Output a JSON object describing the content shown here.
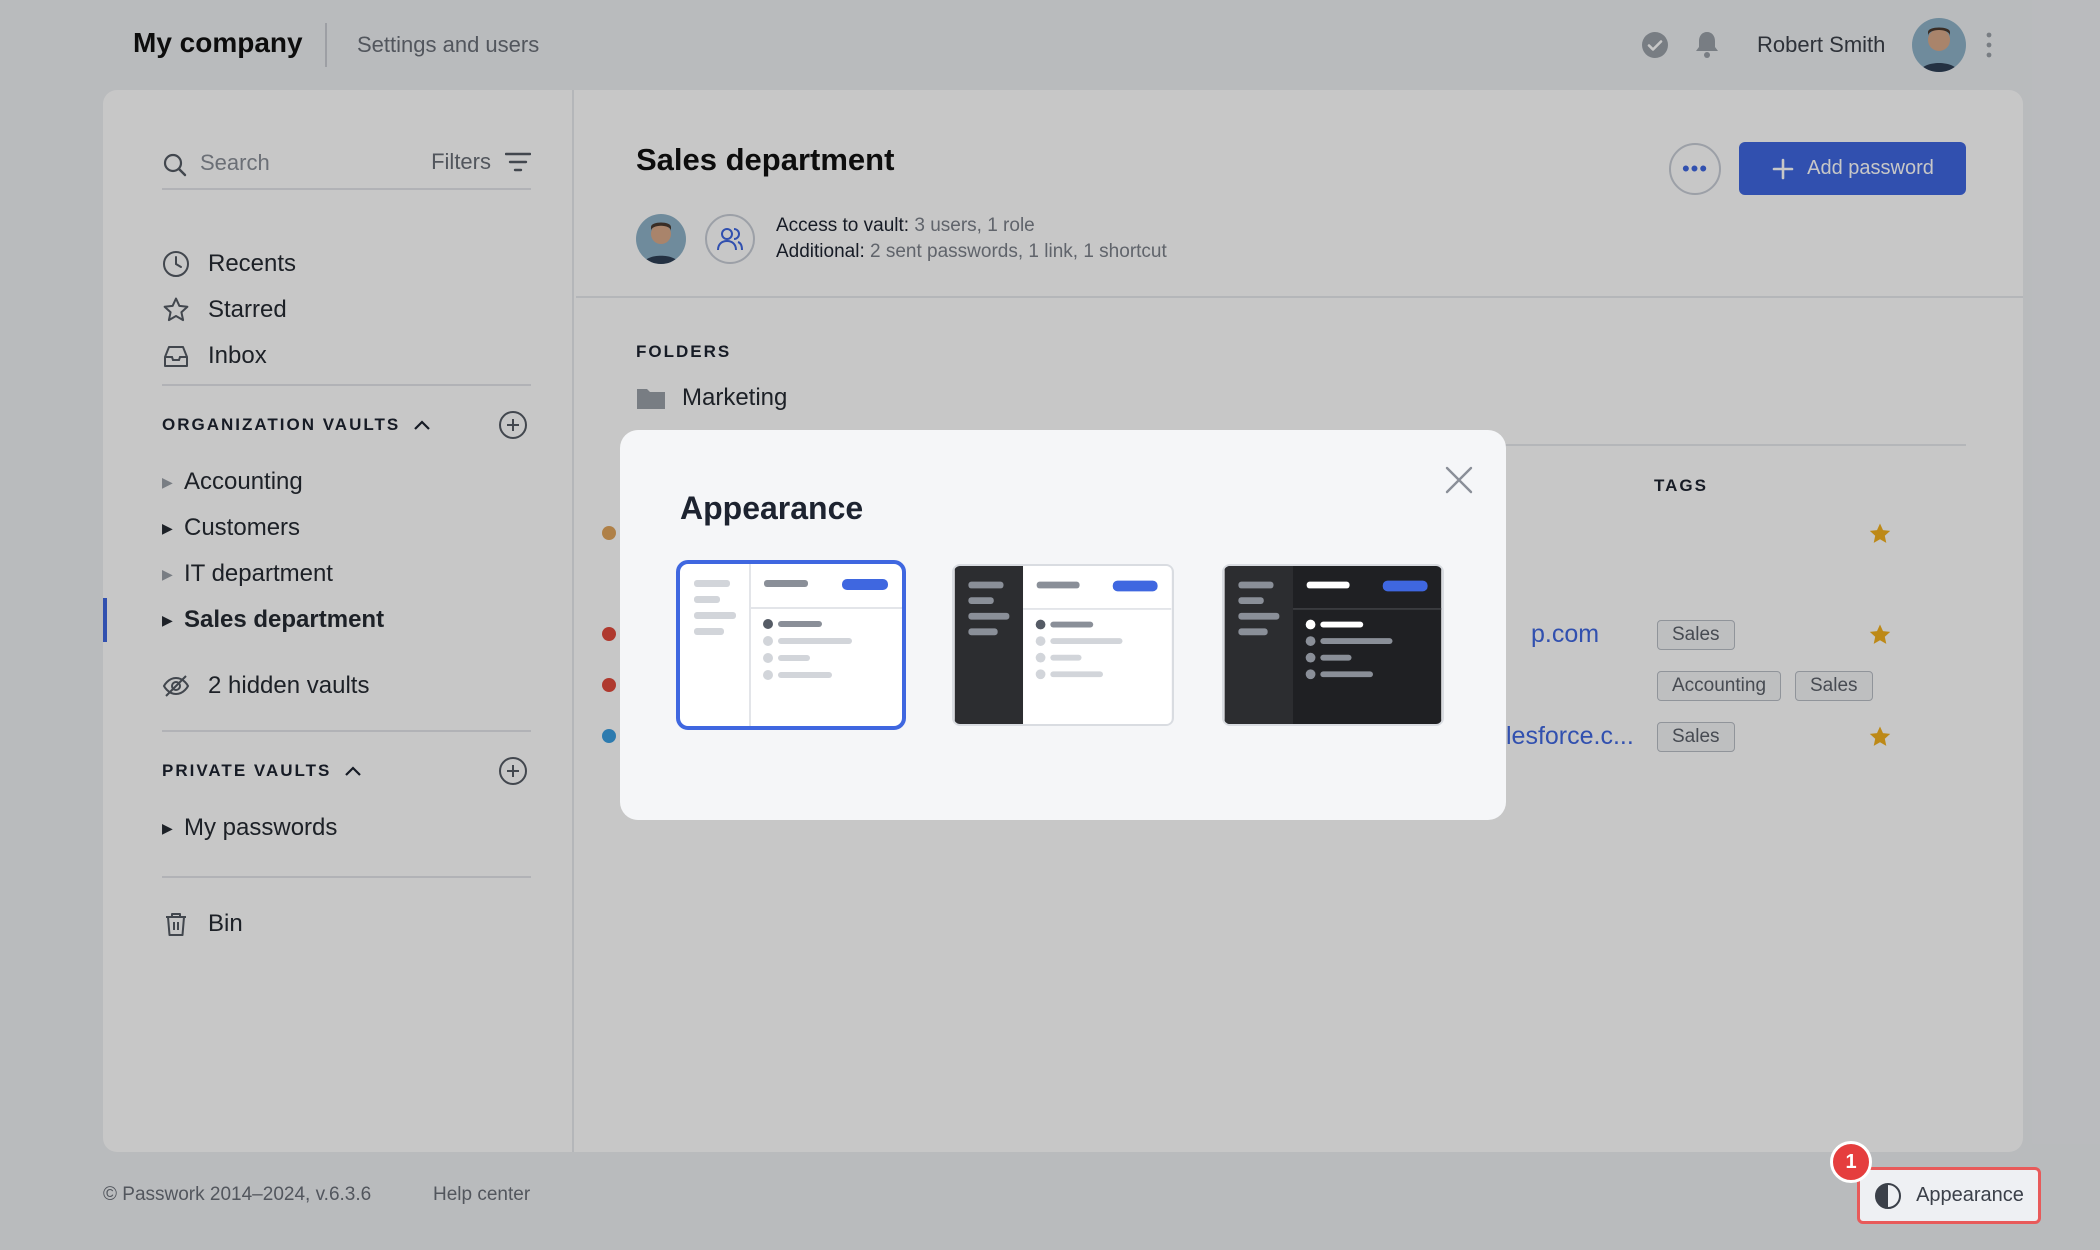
{
  "header": {
    "company": "My company",
    "settings_link": "Settings and users",
    "user_name": "Robert Smith"
  },
  "sidebar": {
    "search_placeholder": "Search",
    "filters_label": "Filters",
    "nav": [
      {
        "label": "Recents",
        "icon": "clock-icon"
      },
      {
        "label": "Starred",
        "icon": "star-icon"
      },
      {
        "label": "Inbox",
        "icon": "inbox-icon"
      }
    ],
    "org_vaults_title": "ORGANIZATION VAULTS",
    "org_vaults": [
      {
        "label": "Accounting"
      },
      {
        "label": "Customers"
      },
      {
        "label": "IT department"
      },
      {
        "label": "Sales department",
        "active": true
      }
    ],
    "hidden_vaults": "2 hidden vaults",
    "private_vaults_title": "PRIVATE VAULTS",
    "private_vaults": [
      {
        "label": "My passwords"
      }
    ],
    "bin": "Bin"
  },
  "main": {
    "title": "Sales department",
    "add_password": "Add password",
    "access_label": "Access to vault:",
    "access_value": "3 users, 1 role",
    "additional_label": "Additional:",
    "additional_value": "2 sent passwords, 1 link, 1 shortcut",
    "folders_title": "FOLDERS",
    "folder": "Marketing",
    "tags_title": "TAGS",
    "rows": [
      {
        "dot_color": "#e0a55c",
        "link": "",
        "tags": [],
        "starred": true
      },
      {
        "dot_color": "#e04a3c",
        "link": "p.com",
        "tags": [
          "Sales"
        ],
        "starred": true
      },
      {
        "dot_color": "#e04a3c",
        "link": "",
        "tags": [
          "Accounting",
          "Sales"
        ],
        "starred": false
      },
      {
        "dot_color": "#3a9ee0",
        "link": "lesforce.c...",
        "tags": [
          "Sales"
        ],
        "starred": true
      }
    ]
  },
  "footer": {
    "copyright": "© Passwork 2014–2024, v.6.3.6",
    "help": "Help center",
    "appearance": "Appearance",
    "badge": "1"
  },
  "modal": {
    "title": "Appearance",
    "themes": [
      {
        "name": "light",
        "selected": true
      },
      {
        "name": "dark-sidebar",
        "selected": false
      },
      {
        "name": "dark",
        "selected": false
      }
    ]
  },
  "colors": {
    "accent": "#3f67e0",
    "highlight": "#e85a5a",
    "star": "#f2b01e"
  }
}
